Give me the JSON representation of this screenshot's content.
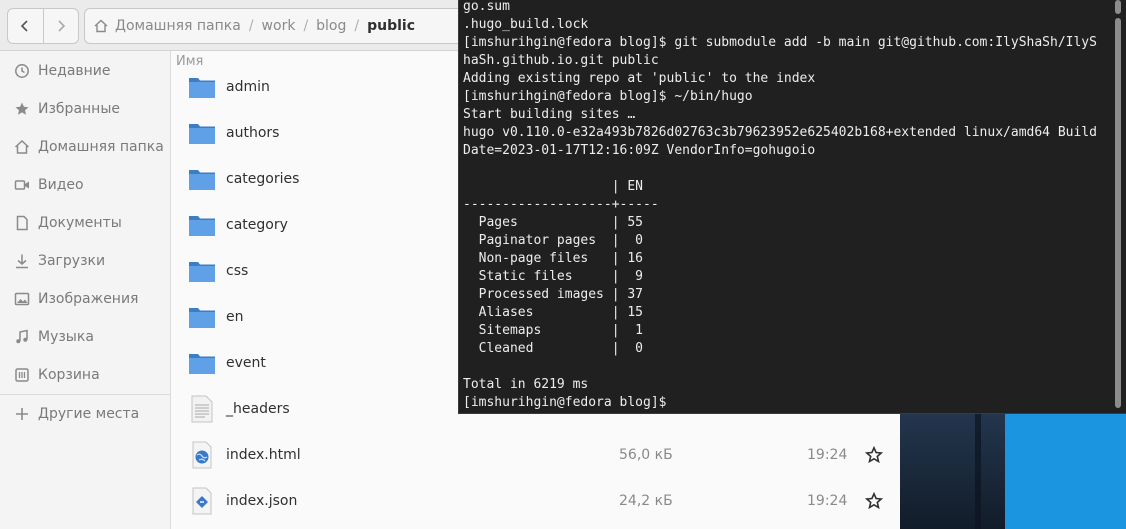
{
  "files_window": {
    "path": [
      "Домашняя папка",
      "work",
      "blog",
      "public"
    ],
    "column_name": "Имя",
    "sidebar": [
      {
        "label": "Недавние",
        "icon": "clock-icon"
      },
      {
        "label": "Избранные",
        "icon": "star-icon"
      },
      {
        "label": "Домашняя папка",
        "icon": "home-icon"
      },
      {
        "label": "Видео",
        "icon": "video-icon"
      },
      {
        "label": "Документы",
        "icon": "document-icon"
      },
      {
        "label": "Загрузки",
        "icon": "download-icon"
      },
      {
        "label": "Изображения",
        "icon": "image-icon"
      },
      {
        "label": "Музыка",
        "icon": "music-icon"
      },
      {
        "label": "Корзина",
        "icon": "trash-icon"
      },
      {
        "label": "Другие места",
        "icon": "plus-icon"
      }
    ],
    "files": [
      {
        "name": "admin",
        "type": "folder",
        "size": "",
        "time": ""
      },
      {
        "name": "authors",
        "type": "folder",
        "size": "",
        "time": ""
      },
      {
        "name": "categories",
        "type": "folder",
        "size": "",
        "time": ""
      },
      {
        "name": "category",
        "type": "folder",
        "size": "",
        "time": ""
      },
      {
        "name": "css",
        "type": "folder",
        "size": "",
        "time": ""
      },
      {
        "name": "en",
        "type": "folder",
        "size": "",
        "time": ""
      },
      {
        "name": "event",
        "type": "folder",
        "size": "",
        "time": ""
      },
      {
        "name": "_headers",
        "type": "text",
        "size": "",
        "time": ""
      },
      {
        "name": "index.html",
        "type": "html",
        "size": "56,0 кБ",
        "time": "19:24"
      },
      {
        "name": "index.json",
        "type": "json",
        "size": "24,2 кБ",
        "time": "19:24"
      }
    ]
  },
  "terminal": {
    "lines": [
      "go.sum",
      ".hugo_build.lock",
      "[imshurihgin@fedora blog]$ git submodule add -b main git@github.com:IlyShaSh/IlyS",
      "haSh.github.io.git public",
      "Adding existing repo at 'public' to the index",
      "[imshurihgin@fedora blog]$ ~/bin/hugo",
      "Start building sites …",
      "hugo v0.110.0-e32a493b7826d02763c3b79623952e625402b168+extended linux/amd64 Build",
      "Date=2023-01-17T12:16:09Z VendorInfo=gohugoio",
      "",
      "                   | EN",
      "-------------------+-----",
      "  Pages            | 55",
      "  Paginator pages  |  0",
      "  Non-page files   | 16",
      "  Static files     |  9",
      "  Processed images | 37",
      "  Aliases          | 15",
      "  Sitemaps         |  1",
      "  Cleaned          |  0",
      "",
      "Total in 6219 ms",
      "[imshurihgin@fedora blog]$ "
    ]
  },
  "colors": {
    "folder": "#4a90d9",
    "terminal_bg": "#202020",
    "desktop_blue": "#1c95e0"
  }
}
